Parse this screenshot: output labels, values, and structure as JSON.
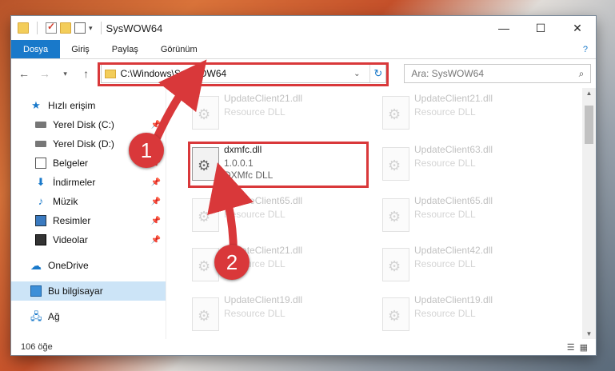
{
  "window": {
    "title": "SysWOW64",
    "minimize": "—",
    "maximize": "☐",
    "close": "✕"
  },
  "ribbon": {
    "tabs": [
      "Dosya",
      "Giriş",
      "Paylaş",
      "Görünüm"
    ],
    "help": "?"
  },
  "address": {
    "path": "C:\\Windows\\SysWOW64"
  },
  "search": {
    "placeholder": "Ara: SysWOW64"
  },
  "sidebar": {
    "items": [
      {
        "label": "Hızlı erişim",
        "icon": "star-icon"
      },
      {
        "label": "Yerel Disk (C:)",
        "icon": "drive-icon",
        "pinned": true
      },
      {
        "label": "Yerel Disk (D:)",
        "icon": "drive-icon",
        "pinned": true
      },
      {
        "label": "Belgeler",
        "icon": "documents-icon",
        "pinned": true
      },
      {
        "label": "İndirmeler",
        "icon": "downloads-icon",
        "pinned": true
      },
      {
        "label": "Müzik",
        "icon": "music-icon",
        "pinned": true
      },
      {
        "label": "Resimler",
        "icon": "pictures-icon",
        "pinned": true
      },
      {
        "label": "Videolar",
        "icon": "videos-icon",
        "pinned": true
      },
      {
        "label": "OneDrive",
        "icon": "cloud-icon"
      },
      {
        "label": "Bu bilgisayar",
        "icon": "computer-icon",
        "selected": true
      },
      {
        "label": "Ağ",
        "icon": "network-icon"
      }
    ]
  },
  "files": [
    {
      "name": "UpdateClient21.dll",
      "sub1": "Resource DLL",
      "faded": true
    },
    {
      "name": "UpdateClient21.dll",
      "sub1": "Resource DLL",
      "faded": true
    },
    {
      "name": "dxmfc.dll",
      "sub1": "1.0.0.1",
      "sub2": "DXMfc DLL",
      "faded": false
    },
    {
      "name": "UpdateClient63.dll",
      "sub1": "Resource DLL",
      "faded": true
    },
    {
      "name": "UpdateClient65.dll",
      "sub1": "Resource DLL",
      "faded": true
    },
    {
      "name": "UpdateClient65.dll",
      "sub1": "Resource DLL",
      "faded": true
    },
    {
      "name": "UpdateClient21.dll",
      "sub1": "Resource DLL",
      "faded": true
    },
    {
      "name": "UpdateClient42.dll",
      "sub1": "Resource DLL",
      "faded": true
    },
    {
      "name": "UpdateClient19.dll",
      "sub1": "Resource DLL",
      "faded": true
    },
    {
      "name": "UpdateClient19.dll",
      "sub1": "Resource DLL",
      "faded": true
    }
  ],
  "status": {
    "count": "106 öğe"
  },
  "callouts": [
    "1",
    "2"
  ],
  "colors": {
    "accent": "#1979ca",
    "highlight": "#d9383a"
  }
}
